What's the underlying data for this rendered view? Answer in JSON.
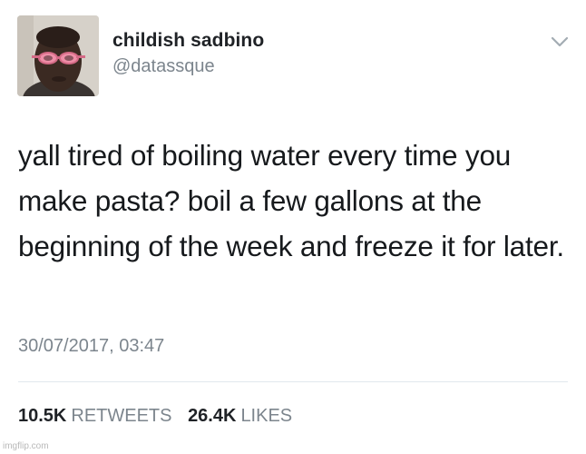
{
  "tweet": {
    "display_name": "childish sadbino",
    "handle": "@datassque",
    "text": "yall tired of boiling water every time you make pasta? boil a few gallons at the beginning of the week and freeze it for later.",
    "timestamp": "30/07/2017, 03:47",
    "retweets_count": "10.5K",
    "retweets_label": "RETWEETS",
    "likes_count": "26.4K",
    "likes_label": "LIKES"
  },
  "watermark": "imgflip.com",
  "icons": {
    "menu": "chevron-down-icon"
  },
  "colors": {
    "secondary_text": "#7c858d",
    "primary_text": "#16191c",
    "divider": "#e1e8ed"
  }
}
